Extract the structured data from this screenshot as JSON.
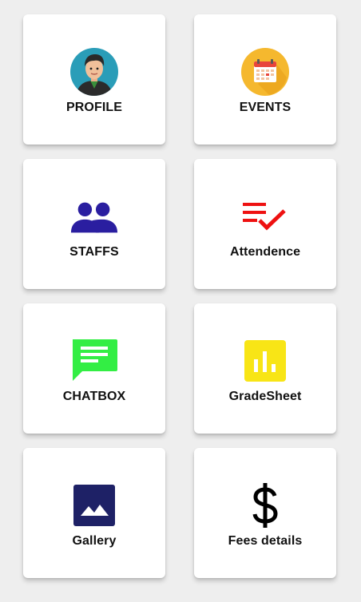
{
  "tiles": [
    {
      "label": "PROFILE",
      "icon": "profile-avatar-icon"
    },
    {
      "label": "EVENTS",
      "icon": "calendar-icon"
    },
    {
      "label": "STAFFS",
      "icon": "people-icon"
    },
    {
      "label": "Attendence",
      "icon": "checklist-icon"
    },
    {
      "label": "CHATBOX",
      "icon": "chat-bubble-icon"
    },
    {
      "label": "GradeSheet",
      "icon": "bar-chart-icon"
    },
    {
      "label": "Gallery",
      "icon": "image-icon"
    },
    {
      "label": "Fees details",
      "icon": "dollar-icon"
    }
  ],
  "colors": {
    "background": "#eeeeee",
    "card": "#ffffff",
    "profile_circle": "#2a9db8",
    "events_circle": "#f5b82e",
    "staffs_icon": "#2a1ea0",
    "attendence_icon": "#ee1111",
    "chatbox_icon": "#33ee44",
    "gradesheet_icon": "#f8e516",
    "gallery_icon": "#1e2166",
    "fees_icon": "#000000"
  }
}
